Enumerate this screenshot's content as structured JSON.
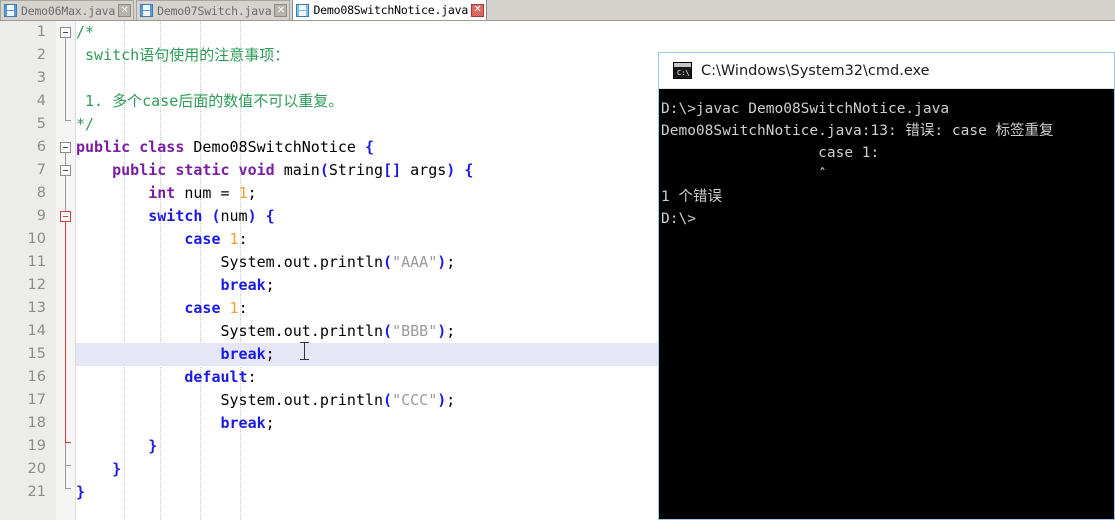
{
  "tabs": [
    {
      "label": "Demo06Max.java",
      "active": false,
      "close": "✕",
      "icon": "save-disk-icon"
    },
    {
      "label": "Demo07Switch.java",
      "active": false,
      "close": "✕",
      "icon": "save-disk-icon"
    },
    {
      "label": "Demo08SwitchNotice.java",
      "active": true,
      "close": "✕",
      "icon": "save-disk-icon"
    }
  ],
  "editor": {
    "line_numbers": [
      "1",
      "2",
      "3",
      "4",
      "5",
      "6",
      "7",
      "8",
      "9",
      "10",
      "11",
      "12",
      "13",
      "14",
      "15",
      "16",
      "17",
      "18",
      "19",
      "20",
      "21"
    ],
    "lines": [
      "/*",
      " switch语句使用的注意事项：",
      "",
      " 1. 多个case后面的数值不可以重复。",
      "*/",
      "public class Demo08SwitchNotice {",
      "    public static void main(String[] args) {",
      "        int num = 1;",
      "        switch (num) {",
      "            case 1:",
      "                System.out.println(\"AAA\");",
      "                break;",
      "            case 1:",
      "                System.out.println(\"BBB\");",
      "                break;",
      "            default:",
      "                System.out.println(\"CCC\");",
      "                break;",
      "        }",
      "    }",
      "}"
    ],
    "highlighted_line": "15",
    "error_fold_line": "9",
    "tokens": {
      "comment_color": "#2e9b57",
      "keyword_color": "#7a1fa2",
      "control_keyword_color": "#1a1ae0",
      "number_color": "#f0a030",
      "string_color": "#9b9b9b",
      "plain_color": "#000000",
      "current_line_bg": "#e6e6f7"
    }
  },
  "console": {
    "title": "C:\\Windows\\System32\\cmd.exe",
    "icon": "cmd-prompt-icon",
    "lines": [
      "D:\\>javac Demo08SwitchNotice.java",
      "Demo08SwitchNotice.java:13: 错误: case 标签重复",
      "                  case 1:",
      "                  ˆ",
      "1 个错误",
      "",
      "D:\\>"
    ]
  }
}
